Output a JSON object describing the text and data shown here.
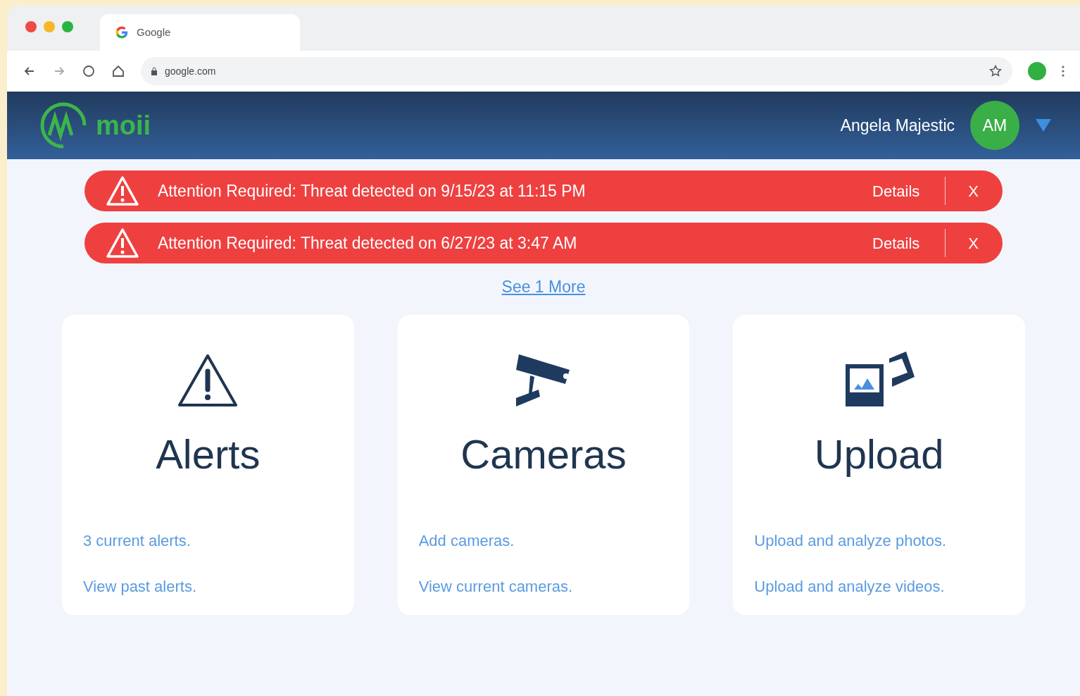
{
  "browser": {
    "tab_title": "Google",
    "url": "google.com"
  },
  "header": {
    "brand": "moii",
    "user_name": "Angela Majestic",
    "avatar_initials": "AM"
  },
  "alerts": [
    {
      "message": "Attention Required: Threat detected on 9/15/23 at 11:15 PM",
      "action": "Details",
      "dismiss": "X"
    },
    {
      "message": "Attention Required: Threat detected on 6/27/23 at 3:47 AM",
      "action": "Details",
      "dismiss": "X"
    }
  ],
  "see_more": "See 1 More",
  "cards": [
    {
      "kind": "alerts",
      "title": "Alerts",
      "links": [
        "3 current alerts.",
        "View past alerts."
      ]
    },
    {
      "kind": "cameras",
      "title": "Cameras",
      "links": [
        "Add cameras.",
        "View current cameras."
      ]
    },
    {
      "kind": "upload",
      "title": "Upload",
      "links": [
        "Upload and analyze photos.",
        "Upload and analyze videos."
      ]
    }
  ]
}
